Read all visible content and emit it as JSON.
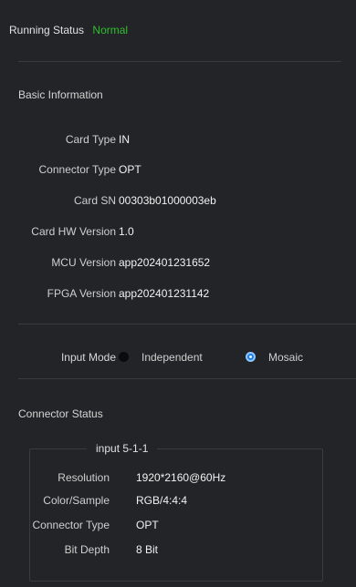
{
  "running_status": {
    "label": "Running Status",
    "value": "Normal",
    "value_color": "#2fbf2f"
  },
  "basic_info": {
    "title": "Basic Information",
    "rows": [
      {
        "label": "Card Type",
        "value": "IN"
      },
      {
        "label": "Connector Type",
        "value": "OPT"
      },
      {
        "label": "Card SN",
        "value": "00303b01000003eb"
      },
      {
        "label": "Card HW Version",
        "value": "1.0"
      },
      {
        "label": "MCU Version",
        "value": "app202401231652"
      },
      {
        "label": "FPGA Version",
        "value": "app202401231142"
      }
    ]
  },
  "input_mode": {
    "label": "Input Mode",
    "options": [
      {
        "label": "Independent",
        "selected": false
      },
      {
        "label": "Mosaic",
        "selected": true
      }
    ]
  },
  "connector_status": {
    "title": "Connector Status",
    "group_title": "input 5-1-1",
    "rows": [
      {
        "label": "Resolution",
        "value": "1920*2160@60Hz"
      },
      {
        "label": "Color/Sample",
        "value": "RGB/4:4:4"
      },
      {
        "label": "Connector Type",
        "value": "OPT"
      },
      {
        "label": "Bit Depth",
        "value": "8 Bit"
      }
    ]
  },
  "colors": {
    "background": "#1b1c1f",
    "panel": "#232427",
    "accent": "#1e7ee8"
  }
}
